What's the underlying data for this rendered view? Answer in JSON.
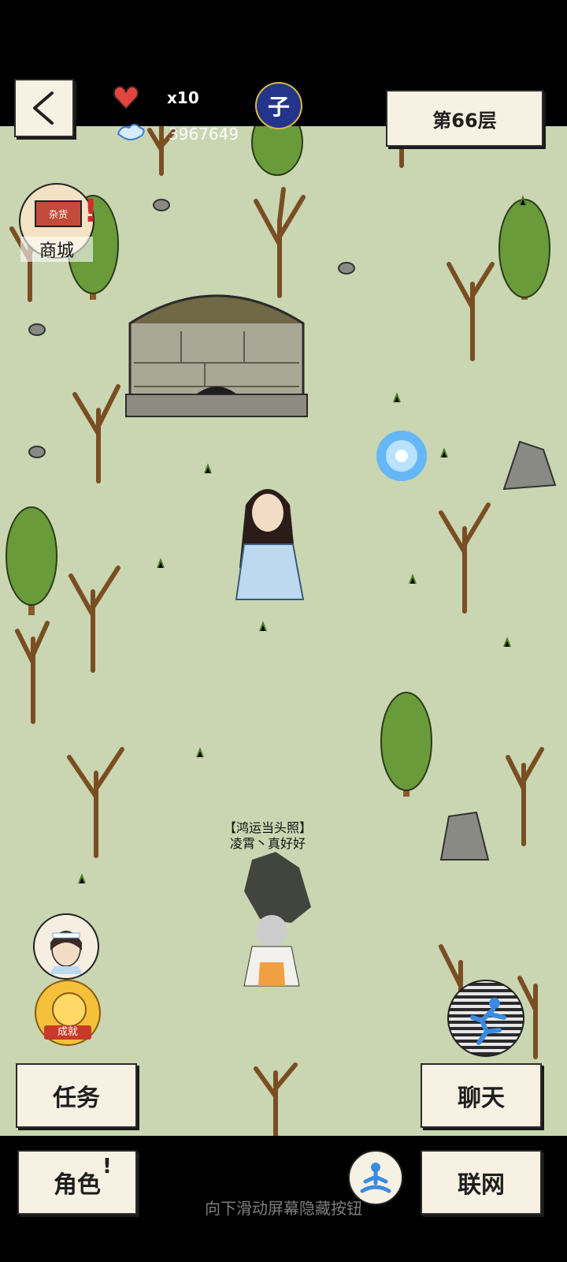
{
  "hud": {
    "back_icon": "chevron-left-icon",
    "lives_icon": "heart-icon",
    "lives_count": "x10",
    "currency_icon": "cloud-icon",
    "currency_value": "3967649",
    "time_badge": "子",
    "floor_label": "第66层"
  },
  "shop": {
    "label": "商城",
    "sign": "杂货"
  },
  "player": {
    "title": "【鸿运当头照】",
    "name": "凌霄丶真好好"
  },
  "side": {
    "achievement_label": "成就"
  },
  "buttons": {
    "task": "任务",
    "chat": "聊天",
    "role": "角色",
    "role_badge": "!",
    "network": "联网"
  },
  "hint": "向下滑动屏幕隐藏按钮",
  "colors": {
    "ground": "#c9d6b1",
    "paper": "#f6f1e2",
    "tree": "#6a9b3a",
    "trunk": "#8b5a2b"
  }
}
